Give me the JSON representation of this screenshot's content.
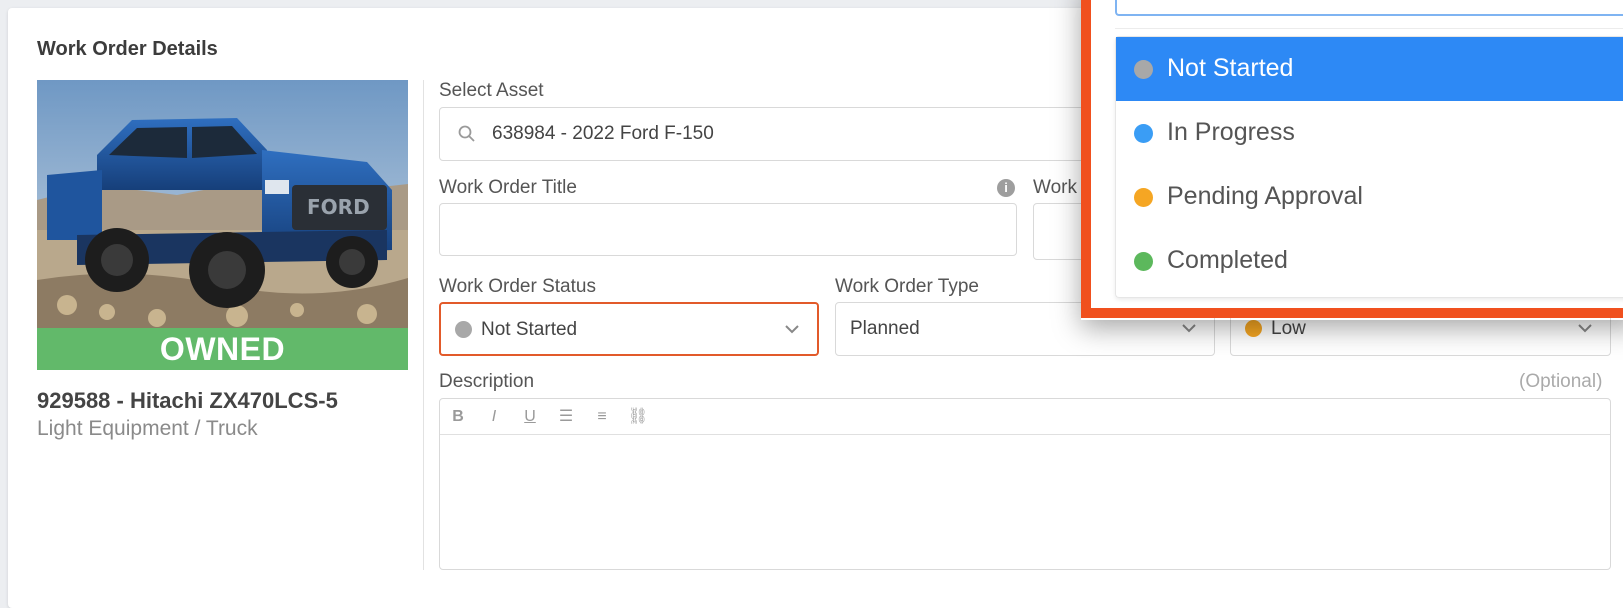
{
  "page": {
    "title": "Work Order Details"
  },
  "asset_panel": {
    "banner": "OWNED",
    "name": "929588 - Hitachi ZX470LCS-5",
    "category": "Light Equipment / Truck"
  },
  "form": {
    "select_asset": {
      "label": "Select Asset",
      "value": "638984 - 2022 Ford F-150",
      "icon": "search-icon"
    },
    "title": {
      "label": "Work Order Title",
      "value": "",
      "icon": "info-icon"
    },
    "work_partial": {
      "label": "Work"
    },
    "status": {
      "label": "Work Order Status",
      "value": "Not Started",
      "dot_color": "#a8a8a8"
    },
    "type": {
      "label": "Work Order Type",
      "value": "Planned"
    },
    "priority": {
      "value": "Low",
      "dot_color": "#f5a623"
    },
    "description": {
      "label": "Description",
      "optional": "(Optional)",
      "toolbar": [
        "bold-icon",
        "italic-icon",
        "underline-icon",
        "bullet-list-icon",
        "numbered-list-icon",
        "link-icon"
      ],
      "toolbar_glyphs": [
        "B",
        "I",
        "U",
        "☰",
        "≡",
        "⛓"
      ]
    }
  },
  "status_dropdown": {
    "options": [
      {
        "label": "Not Started",
        "color": "#a8a8a8",
        "selected": true
      },
      {
        "label": "In Progress",
        "color": "#3a9df5",
        "selected": false
      },
      {
        "label": "Pending Approval",
        "color": "#f5a623",
        "selected": false
      },
      {
        "label": "Completed",
        "color": "#5cb85c",
        "selected": false
      }
    ],
    "highlight_color": "#f0501e",
    "selected_bg": "#2d89f5"
  }
}
